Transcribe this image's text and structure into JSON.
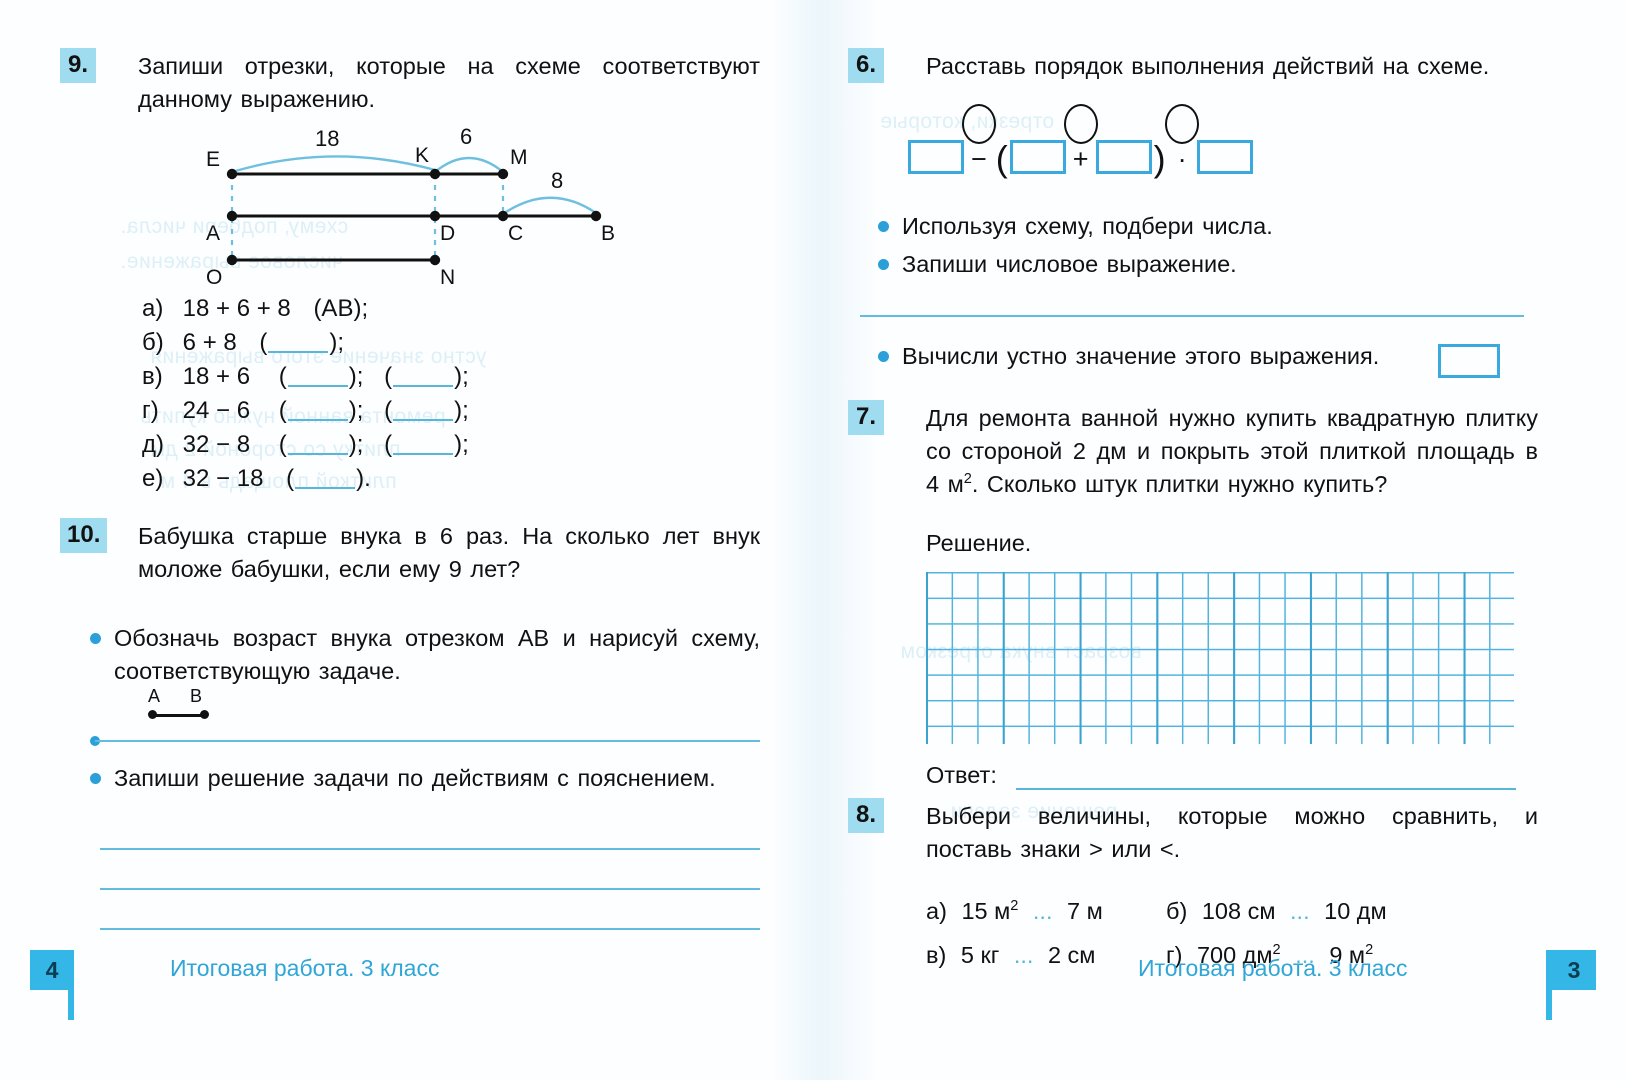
{
  "left_page": {
    "task9": {
      "number": "9.",
      "prompt": "Запиши отрезки, которые на схеме соответствуют данному выражению.",
      "diagram": {
        "labels": [
          "E",
          "K",
          "M",
          "A",
          "D",
          "C",
          "B",
          "O",
          "N"
        ],
        "arc_values": [
          "18",
          "6",
          "8"
        ]
      },
      "items": [
        {
          "label": "а)",
          "expr": "18 + 6 + 8",
          "answers": [
            "(AB);"
          ]
        },
        {
          "label": "б)",
          "expr": "6 + 8",
          "blanks": 1,
          "tail": ";"
        },
        {
          "label": "в)",
          "expr": "18 + 6",
          "blanks": 2,
          "tail": ";"
        },
        {
          "label": "г)",
          "expr": "24 − 6",
          "blanks": 2,
          "tail": ";"
        },
        {
          "label": "д)",
          "expr": "32 − 8",
          "blanks": 2,
          "tail": ";"
        },
        {
          "label": "е)",
          "expr": "32 − 18",
          "blanks": 1,
          "tail": "."
        }
      ]
    },
    "task10": {
      "number": "10.",
      "prompt": "Бабушка старше внука в 6 раз. На сколько лет внук моложе бабушки, если ему 9 лет?",
      "bullet1": "Обозначь возраст внука отрезком AB и нарисуй схему, соответствующую задаче.",
      "segment_labels": {
        "a": "A",
        "b": "B"
      },
      "bullet2": "Запиши решение задачи по действиям с пояснением."
    },
    "footer": {
      "caption": "Итоговая работа. 3 класс",
      "page": "4"
    }
  },
  "right_page": {
    "task6": {
      "number": "6.",
      "prompt": "Расставь порядок выполнения действий на схеме.",
      "expression": {
        "operators": [
          "−",
          "+",
          "·"
        ],
        "open_paren": "(",
        "close_paren": ")",
        "box_count": 4,
        "circle_count": 3
      },
      "bullet1": "Используя схему, подбери числа.",
      "bullet2": "Запиши числовое выражение.",
      "bullet3": "Вычисли устно значение этого выражения."
    },
    "task7": {
      "number": "7.",
      "prompt_part1": "Для ремонта ванной нужно купить квадратную плитку со стороной 2 дм и покрыть этой плиткой площадь в 4 м",
      "prompt_sup": "2",
      "prompt_part2": ". Сколько штук плитки нужно купить?",
      "solution_label": "Решение.",
      "answer_label": "Ответ:"
    },
    "task8": {
      "number": "8.",
      "prompt": "Выбери величины, которые можно сравнить, и поставь знаки > или <.",
      "rows": [
        {
          "label": "а)",
          "left": "15 м",
          "left_sup": "2",
          "dots": "...",
          "right": "7 м",
          "right_sup": ""
        },
        {
          "label": "б)",
          "left": "108 см",
          "left_sup": "",
          "dots": "...",
          "right": "10 дм",
          "right_sup": ""
        },
        {
          "label": "в)",
          "left": "5 кг",
          "left_sup": "",
          "dots": "...",
          "right": "2 см",
          "right_sup": ""
        },
        {
          "label": "г)",
          "left": "700 дм",
          "left_sup": "2",
          "dots": "...",
          "right": "9 м",
          "right_sup": "2"
        }
      ]
    },
    "footer": {
      "caption": "Итоговая работа. 3 класс",
      "page": "3"
    }
  },
  "colors": {
    "accent_blue": "#34b7e6",
    "badge_blue": "#9fdcef",
    "rule_blue": "#5ab6d8",
    "box_blue": "#3aa9dd",
    "ink": "#111111"
  }
}
